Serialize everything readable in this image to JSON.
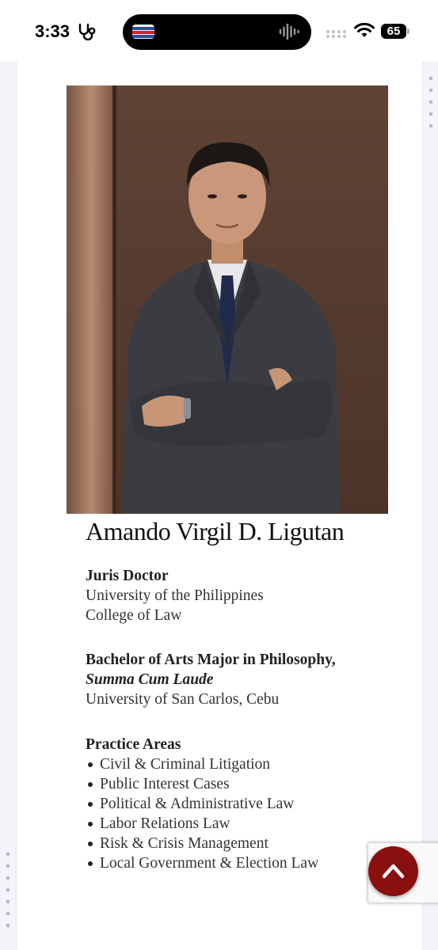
{
  "status_bar": {
    "time": "3:33",
    "battery": "65"
  },
  "profile": {
    "name": "Amando Virgil D. Ligutan",
    "photo_alt": "Portrait of Amando Virgil D. Ligutan"
  },
  "education": [
    {
      "degree": "Juris Doctor",
      "honors": "",
      "lines": [
        "University of the Philippines",
        "College of Law"
      ]
    },
    {
      "degree": "Bachelor of Arts Major in Philosophy,",
      "honors": "Summa Cum Laude",
      "lines": [
        "University of San Carlos, Cebu"
      ]
    }
  ],
  "practice": {
    "heading": "Practice Areas",
    "items": [
      "Civil & Criminal Litigation",
      "Public Interest Cases",
      "Political & Administrative Law",
      "Labor Relations Law",
      "Risk & Crisis Management",
      "Local Government & Election Law"
    ]
  },
  "icons": {
    "stethoscope": "stethoscope-icon",
    "waveform": "waveform-icon",
    "signal": "signal-icon",
    "wifi": "wifi-icon",
    "scroll_top": "chevron-up-icon"
  },
  "colors": {
    "accent": "#8a0f0f",
    "text": "#333333",
    "page_bg": "#f4f4fb"
  }
}
